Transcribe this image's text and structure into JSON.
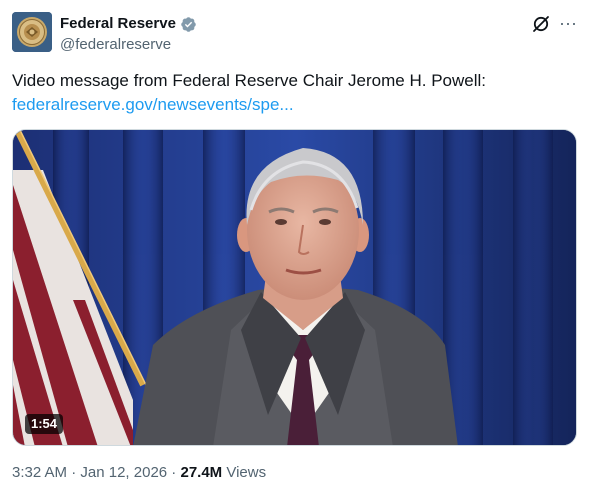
{
  "author": {
    "display_name": "Federal Reserve",
    "handle": "@federalreserve",
    "verified": true,
    "avatar_icon": "federal-reserve-seal-icon"
  },
  "actions": {
    "grok_icon": "grok-icon",
    "more_icon": "more-options-icon",
    "more_label": "···"
  },
  "tweet": {
    "text": "Video message from Federal Reserve Chair Jerome H. Powell:",
    "link": "federalreserve.gov/newsevents/spe..."
  },
  "media": {
    "type": "video",
    "duration": "1:54"
  },
  "meta": {
    "time": "3:32 AM",
    "separator1": " · ",
    "date": "Jan 12, 2026",
    "separator2": " · ",
    "views_count": "27.4M",
    "views_label": " Views"
  },
  "colors": {
    "link": "#1d9bf0",
    "secondary_text": "#536471",
    "verified_badge": "#829aab"
  }
}
